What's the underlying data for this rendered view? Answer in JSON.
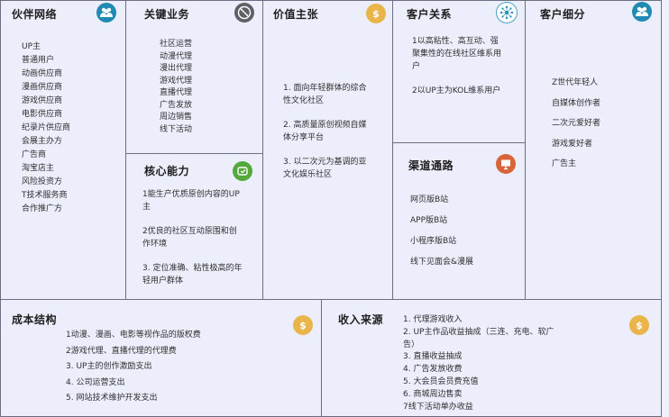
{
  "partners": {
    "title": "伙伴网络",
    "icon": "people-icon",
    "items": [
      "UP主",
      "普通用户",
      "动画供应商",
      "漫画供应商",
      "游戏供应商",
      "电影供应商",
      "纪录片供应商",
      "会展主办方",
      "广告商",
      "淘宝店主",
      "风险投资方",
      "T技术服务商",
      "合作推广方"
    ]
  },
  "activities": {
    "title": "关键业务",
    "icon": "baseball-icon",
    "items": [
      "社区运营",
      "动漫代理",
      "漫出代理",
      "游戏代理",
      "直播代理",
      "广告发放",
      "周边销售",
      "线下活动"
    ]
  },
  "resources": {
    "title": "核心能力",
    "icon": "clock-icon",
    "items": [
      "1能生产优质原创内容的UP主",
      "2优良的社区互动原围和创作环境",
      "3. 定位准确、粘性极高的年轻用户群体"
    ]
  },
  "value": {
    "title": "价值主张",
    "icon": "money-bag-icon",
    "items": [
      "1. 面向年轻群体的综合性文化社区",
      "2. 高质量原创视频自媒体分享平台",
      "3. 以二次元为基调的亚文化娱乐社区"
    ]
  },
  "relationships": {
    "title": "客户关系",
    "icon": "network-icon",
    "items": [
      "1以高粘性、高互动、强聚集性的在线社区维系用户",
      "2以UP主为KOL维系用户"
    ]
  },
  "channels": {
    "title": "渠道通路",
    "icon": "presentation-icon",
    "items": [
      "网页版B站",
      "APP版B站",
      "小程序版B站",
      "线下见面会&漫展"
    ]
  },
  "segments": {
    "title": "客户细分",
    "icon": "people-icon",
    "items": [
      "Z世代年轻人",
      "自媒体创作者",
      "二次元爱好者",
      "游戏爱好者",
      "广告主"
    ]
  },
  "costs": {
    "title": "成本结构",
    "icon": "money-bag-icon",
    "items": [
      "1动漫、漫画、电影等视作品的版权费",
      "2游戏代理、直播代理的代理费",
      "3. UP主的创作激励支出",
      "4. 公司运营支出",
      "5. 网站技术维护开发支出"
    ]
  },
  "revenue": {
    "title": "收入来源",
    "icon": "money-bag-icon",
    "items": [
      "1. 代理游戏收入",
      "2. UP主作品收益抽成（三连、充电、软广告）",
      "3. 直播收益抽成",
      "4. 广告发放收费",
      "5. 大会员会员费充值",
      "6. 商城周边售卖",
      "7线下活动单办收益"
    ]
  },
  "colors": {
    "teal": "#1f8ab3",
    "gray": "#5e6066",
    "green": "#53a93b",
    "gold": "#e9b54b",
    "orange": "#d9643c",
    "cell_bg": "#eceefb",
    "border": "#6b6e85"
  }
}
